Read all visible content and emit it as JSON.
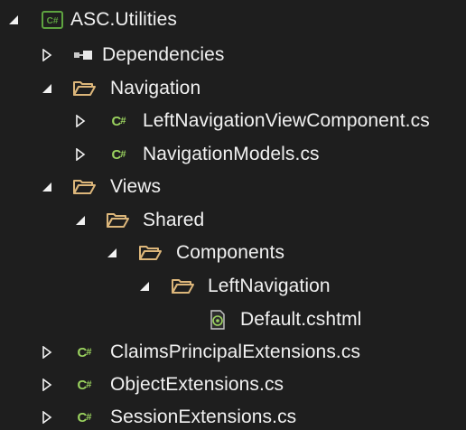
{
  "colors": {
    "background": "#1e1e1e",
    "text": "#f1f1f1",
    "folder": "#dcb67a",
    "csharp": "#9bd35f",
    "project_badge": "#5ea340"
  },
  "tree": {
    "items": [
      {
        "label": "ASC.Utilities",
        "icon": "csharp-project-icon",
        "expander": "expanded"
      },
      {
        "label": "Dependencies",
        "icon": "dependencies-icon",
        "expander": "collapsed"
      },
      {
        "label": "Navigation",
        "icon": "folder-open-icon",
        "expander": "expanded"
      },
      {
        "label": "LeftNavigationViewComponent.cs",
        "icon": "csharp-file-icon",
        "expander": "collapsed"
      },
      {
        "label": "NavigationModels.cs",
        "icon": "csharp-file-icon",
        "expander": "collapsed"
      },
      {
        "label": "Views",
        "icon": "folder-open-icon",
        "expander": "expanded"
      },
      {
        "label": "Shared",
        "icon": "folder-open-icon",
        "expander": "expanded"
      },
      {
        "label": "Components",
        "icon": "folder-open-icon",
        "expander": "expanded"
      },
      {
        "label": "LeftNavigation",
        "icon": "folder-open-icon",
        "expander": "expanded"
      },
      {
        "label": "Default.cshtml",
        "icon": "razor-file-icon",
        "expander": "none"
      },
      {
        "label": "ClaimsPrincipalExtensions.cs",
        "icon": "csharp-file-icon",
        "expander": "collapsed"
      },
      {
        "label": "ObjectExtensions.cs",
        "icon": "csharp-file-icon",
        "expander": "collapsed"
      },
      {
        "label": "SessionExtensions.cs",
        "icon": "csharp-file-icon",
        "expander": "collapsed"
      }
    ]
  }
}
